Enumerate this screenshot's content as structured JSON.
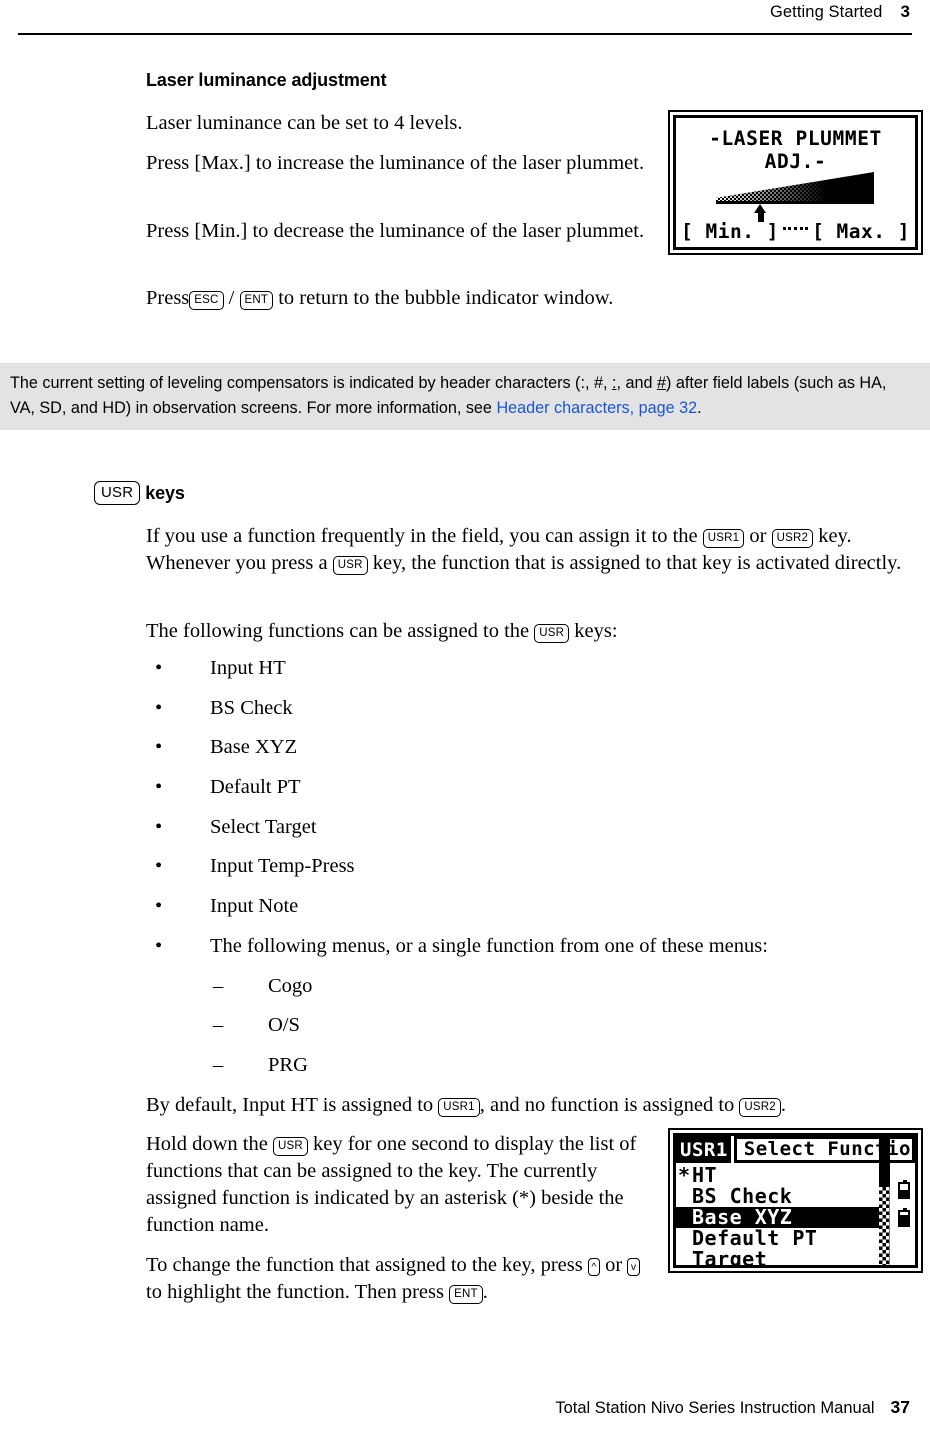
{
  "header": {
    "section": "Getting Started",
    "chapter": "3"
  },
  "footer": {
    "manual": "Total Station Nivo Series Instruction Manual",
    "page": "37"
  },
  "laser_section": {
    "heading": "Laser luminance adjustment",
    "p1": "Laser luminance can be set to 4 levels.",
    "p2": "Press [Max.] to increase the luminance of the laser plummet.",
    "p3": "Press [Min.] to decrease the luminance of  the laser plummet.",
    "p4_prefix": "Press",
    "p4_key1": "ESC",
    "p4_sep": "/",
    "p4_key2": "ENT",
    "p4_suffix": "to return to the bubble indicator window."
  },
  "lcd_laser": {
    "title": "-LASER PLUMMET ADJ.-",
    "min_label": "[ Min. ]",
    "max_label": "[ Max. ]",
    "marker_position_percent": 33
  },
  "note": {
    "part1": "The current setting of leveling compensators is indicated by header characters (:, #, ",
    "uline1": ":",
    "part2": ", and ",
    "uline2": "#",
    "part3": ") after field labels (such as HA, VA, SD, and HD) in observation screens. For more information, see ",
    "xref": "Header characters, page 32",
    "part4": ".",
    "xref_color": "#1a56d6",
    "background_color": "#e3e3e3"
  },
  "usr_section": {
    "heading_key": "USR",
    "heading_text": "keys",
    "p1_a": "If you use a function frequently in the field, you can assign it to the",
    "p1_key1": "USR1",
    "p1_b": "or",
    "p1_key2": "USR2",
    "p1_c": "key. Whenever you press a",
    "p1_key3": "USR",
    "p1_d": "key, the function that is assigned to that key is activated directly.",
    "p2_a": "The following functions can be assigned to the",
    "p2_key": "USR",
    "p2_b": "keys:",
    "bullets": [
      "Input HT",
      "BS Check",
      "Base XYZ",
      "Default PT",
      "Select Target",
      "Input Temp-Press",
      "Input Note",
      "The following menus, or a single function from one of these menus:"
    ],
    "sub_bullets": [
      "Cogo",
      "O/S",
      "PRG"
    ],
    "bullet_mark": "•",
    "sub_bullet_mark": "–",
    "default_a": "By default, Input HT is assigned to",
    "default_key1": "USR1",
    "default_b": ", and no function is assigned to",
    "default_key2": "USR2",
    "default_c": ".",
    "hold_a": "Hold down the",
    "hold_key": "USR",
    "hold_b": "key for one second to display the list of functions that can be assigned to the key. The currently assigned function is indicated by an asterisk (*) beside the function name.",
    "change_a": "To change the function that assigned to the key, press",
    "change_key_up": "^",
    "change_b": "or",
    "change_key_down": "v",
    "change_c": "to highlight the function. Then press",
    "change_key_ent": "ENT",
    "change_d": "."
  },
  "lcd_usr": {
    "badge": "USR1",
    "title": "Select Functions",
    "rows": [
      {
        "star": "*",
        "label": "HT",
        "selected": false
      },
      {
        "star": "",
        "label": "BS Check",
        "selected": false
      },
      {
        "star": "",
        "label": "Base XYZ",
        "selected": true
      },
      {
        "star": "",
        "label": "Default PT",
        "selected": false
      },
      {
        "star": "",
        "label": "Target",
        "selected": false
      }
    ]
  }
}
